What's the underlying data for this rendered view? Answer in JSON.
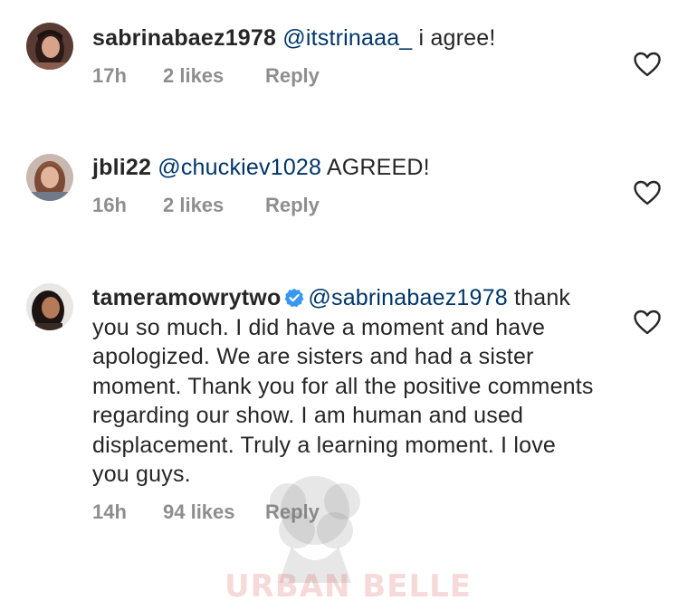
{
  "comments": [
    {
      "username": "sabrinabaez1978",
      "verified": false,
      "mention": "@itstrinaaa_",
      "text": " i agree!",
      "time": "17h",
      "likes": "2 likes",
      "reply": "Reply"
    },
    {
      "username": "jbli22",
      "verified": false,
      "mention": "@chuckiev1028",
      "text": " AGREED!",
      "time": "16h",
      "likes": "2 likes",
      "reply": "Reply"
    },
    {
      "username": "tameramowrytwo",
      "verified": true,
      "mention": "@sabrinabaez1978",
      "text": " thank you so much. I did have a moment and have apologized. We are sisters and had a sister moment. Thank you for all the positive comments regarding our show. I am human and used displacement. Truly a learning moment. I love you guys.",
      "time": "14h",
      "likes": "94 likes",
      "reply": "Reply"
    }
  ],
  "watermark": {
    "text": "URBAN BELLE"
  },
  "colors": {
    "mention": "#003569",
    "verified": "#3897f0",
    "meta": "#8e8e8e",
    "text": "#262626"
  },
  "icons": {
    "like": "heart-outline-icon",
    "verified": "verified-badge-icon"
  }
}
